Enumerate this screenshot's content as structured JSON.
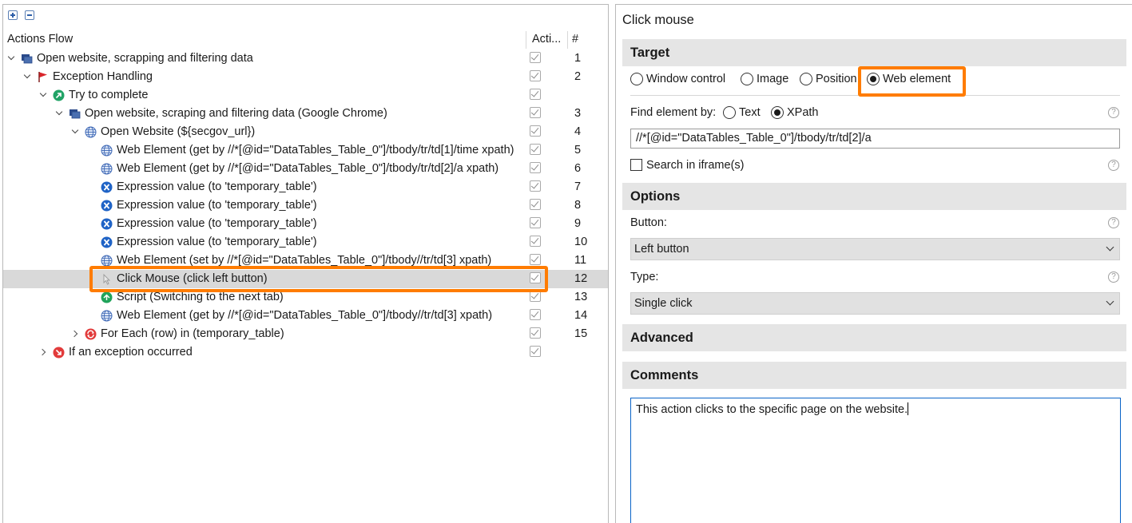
{
  "left_panel": {
    "columns": {
      "flow": "Actions Flow",
      "active": "Acti...",
      "number": "#"
    },
    "rows": [
      {
        "label": "Open website, scrapping and filtering data",
        "number": "1",
        "icon": "window-icon",
        "expand": "down",
        "depth": 0
      },
      {
        "label": "Exception Handling",
        "number": "2",
        "icon": "flag-icon",
        "expand": "down",
        "depth": 1
      },
      {
        "label": "Try to complete",
        "number": "",
        "icon": "arrow-up-right-icon",
        "expand": "down",
        "depth": 2
      },
      {
        "label": "Open website, scraping and filtering data (Google Chrome)",
        "number": "3",
        "icon": "window-icon",
        "expand": "down",
        "depth": 3
      },
      {
        "label": "Open Website (${secgov_url})",
        "number": "4",
        "icon": "globe-icon",
        "expand": "down",
        "depth": 4
      },
      {
        "label": "Web Element (get by //*[@id=\"DataTables_Table_0\"]/tbody/tr/td[1]/time xpath)",
        "number": "5",
        "icon": "globe-icon",
        "expand": "none",
        "depth": 5
      },
      {
        "label": "Web Element (get by //*[@id=\"DataTables_Table_0\"]/tbody/tr/td[2]/a xpath)",
        "number": "6",
        "icon": "globe-icon",
        "expand": "none",
        "depth": 5
      },
      {
        "label": "Expression value (to 'temporary_table')",
        "number": "7",
        "icon": "expression-icon",
        "expand": "none",
        "depth": 5
      },
      {
        "label": "Expression value (to 'temporary_table')",
        "number": "8",
        "icon": "expression-icon",
        "expand": "none",
        "depth": 5
      },
      {
        "label": "Expression value (to 'temporary_table')",
        "number": "9",
        "icon": "expression-icon",
        "expand": "none",
        "depth": 5
      },
      {
        "label": "Expression value (to 'temporary_table')",
        "number": "10",
        "icon": "expression-icon",
        "expand": "none",
        "depth": 5
      },
      {
        "label": "Web Element (set by //*[@id=\"DataTables_Table_0\"]/tbody//tr/td[3] xpath)",
        "number": "11",
        "icon": "globe-icon",
        "expand": "none",
        "depth": 5
      },
      {
        "label": "Click Mouse (click left button)",
        "number": "12",
        "icon": "mouse-icon",
        "expand": "none",
        "depth": 5,
        "selected": true
      },
      {
        "label": "Script (Switching to the next tab)",
        "number": "13",
        "icon": "script-icon",
        "expand": "none",
        "depth": 5
      },
      {
        "label": "Web Element (get by //*[@id=\"DataTables_Table_0\"]/tbody//tr/td[3] xpath)",
        "number": "14",
        "icon": "globe-icon",
        "expand": "none",
        "depth": 5
      },
      {
        "label": "For Each (row) in (temporary_table)",
        "number": "15",
        "icon": "loop-icon",
        "expand": "right",
        "depth": 4
      },
      {
        "label": "If an exception occurred",
        "number": "",
        "icon": "exception-icon",
        "expand": "right",
        "depth": 2
      }
    ]
  },
  "right_panel": {
    "title": "Click mouse",
    "target": {
      "heading": "Target",
      "options": [
        "Window control",
        "Image",
        "Position",
        "Web element"
      ],
      "selected": "Web element",
      "find_by_label": "Find element by:",
      "find_by_options": [
        "Text",
        "XPath"
      ],
      "find_by_selected": "XPath",
      "xpath_value": "//*[@id=\"DataTables_Table_0\"]/tbody/tr/td[2]/a",
      "iframe_label": "Search in iframe(s)"
    },
    "options": {
      "heading": "Options",
      "button_label": "Button:",
      "button_value": "Left button",
      "type_label": "Type:",
      "type_value": "Single click"
    },
    "advanced": {
      "heading": "Advanced"
    },
    "comments": {
      "heading": "Comments",
      "text": "This action clicks to the specific page on the website."
    },
    "help_symbol": "?"
  },
  "colors": {
    "highlight": "#ff7c00",
    "section_bg": "#e5e5e5",
    "selected_row": "#d9d9d9",
    "focus_border": "#0a64c8"
  }
}
